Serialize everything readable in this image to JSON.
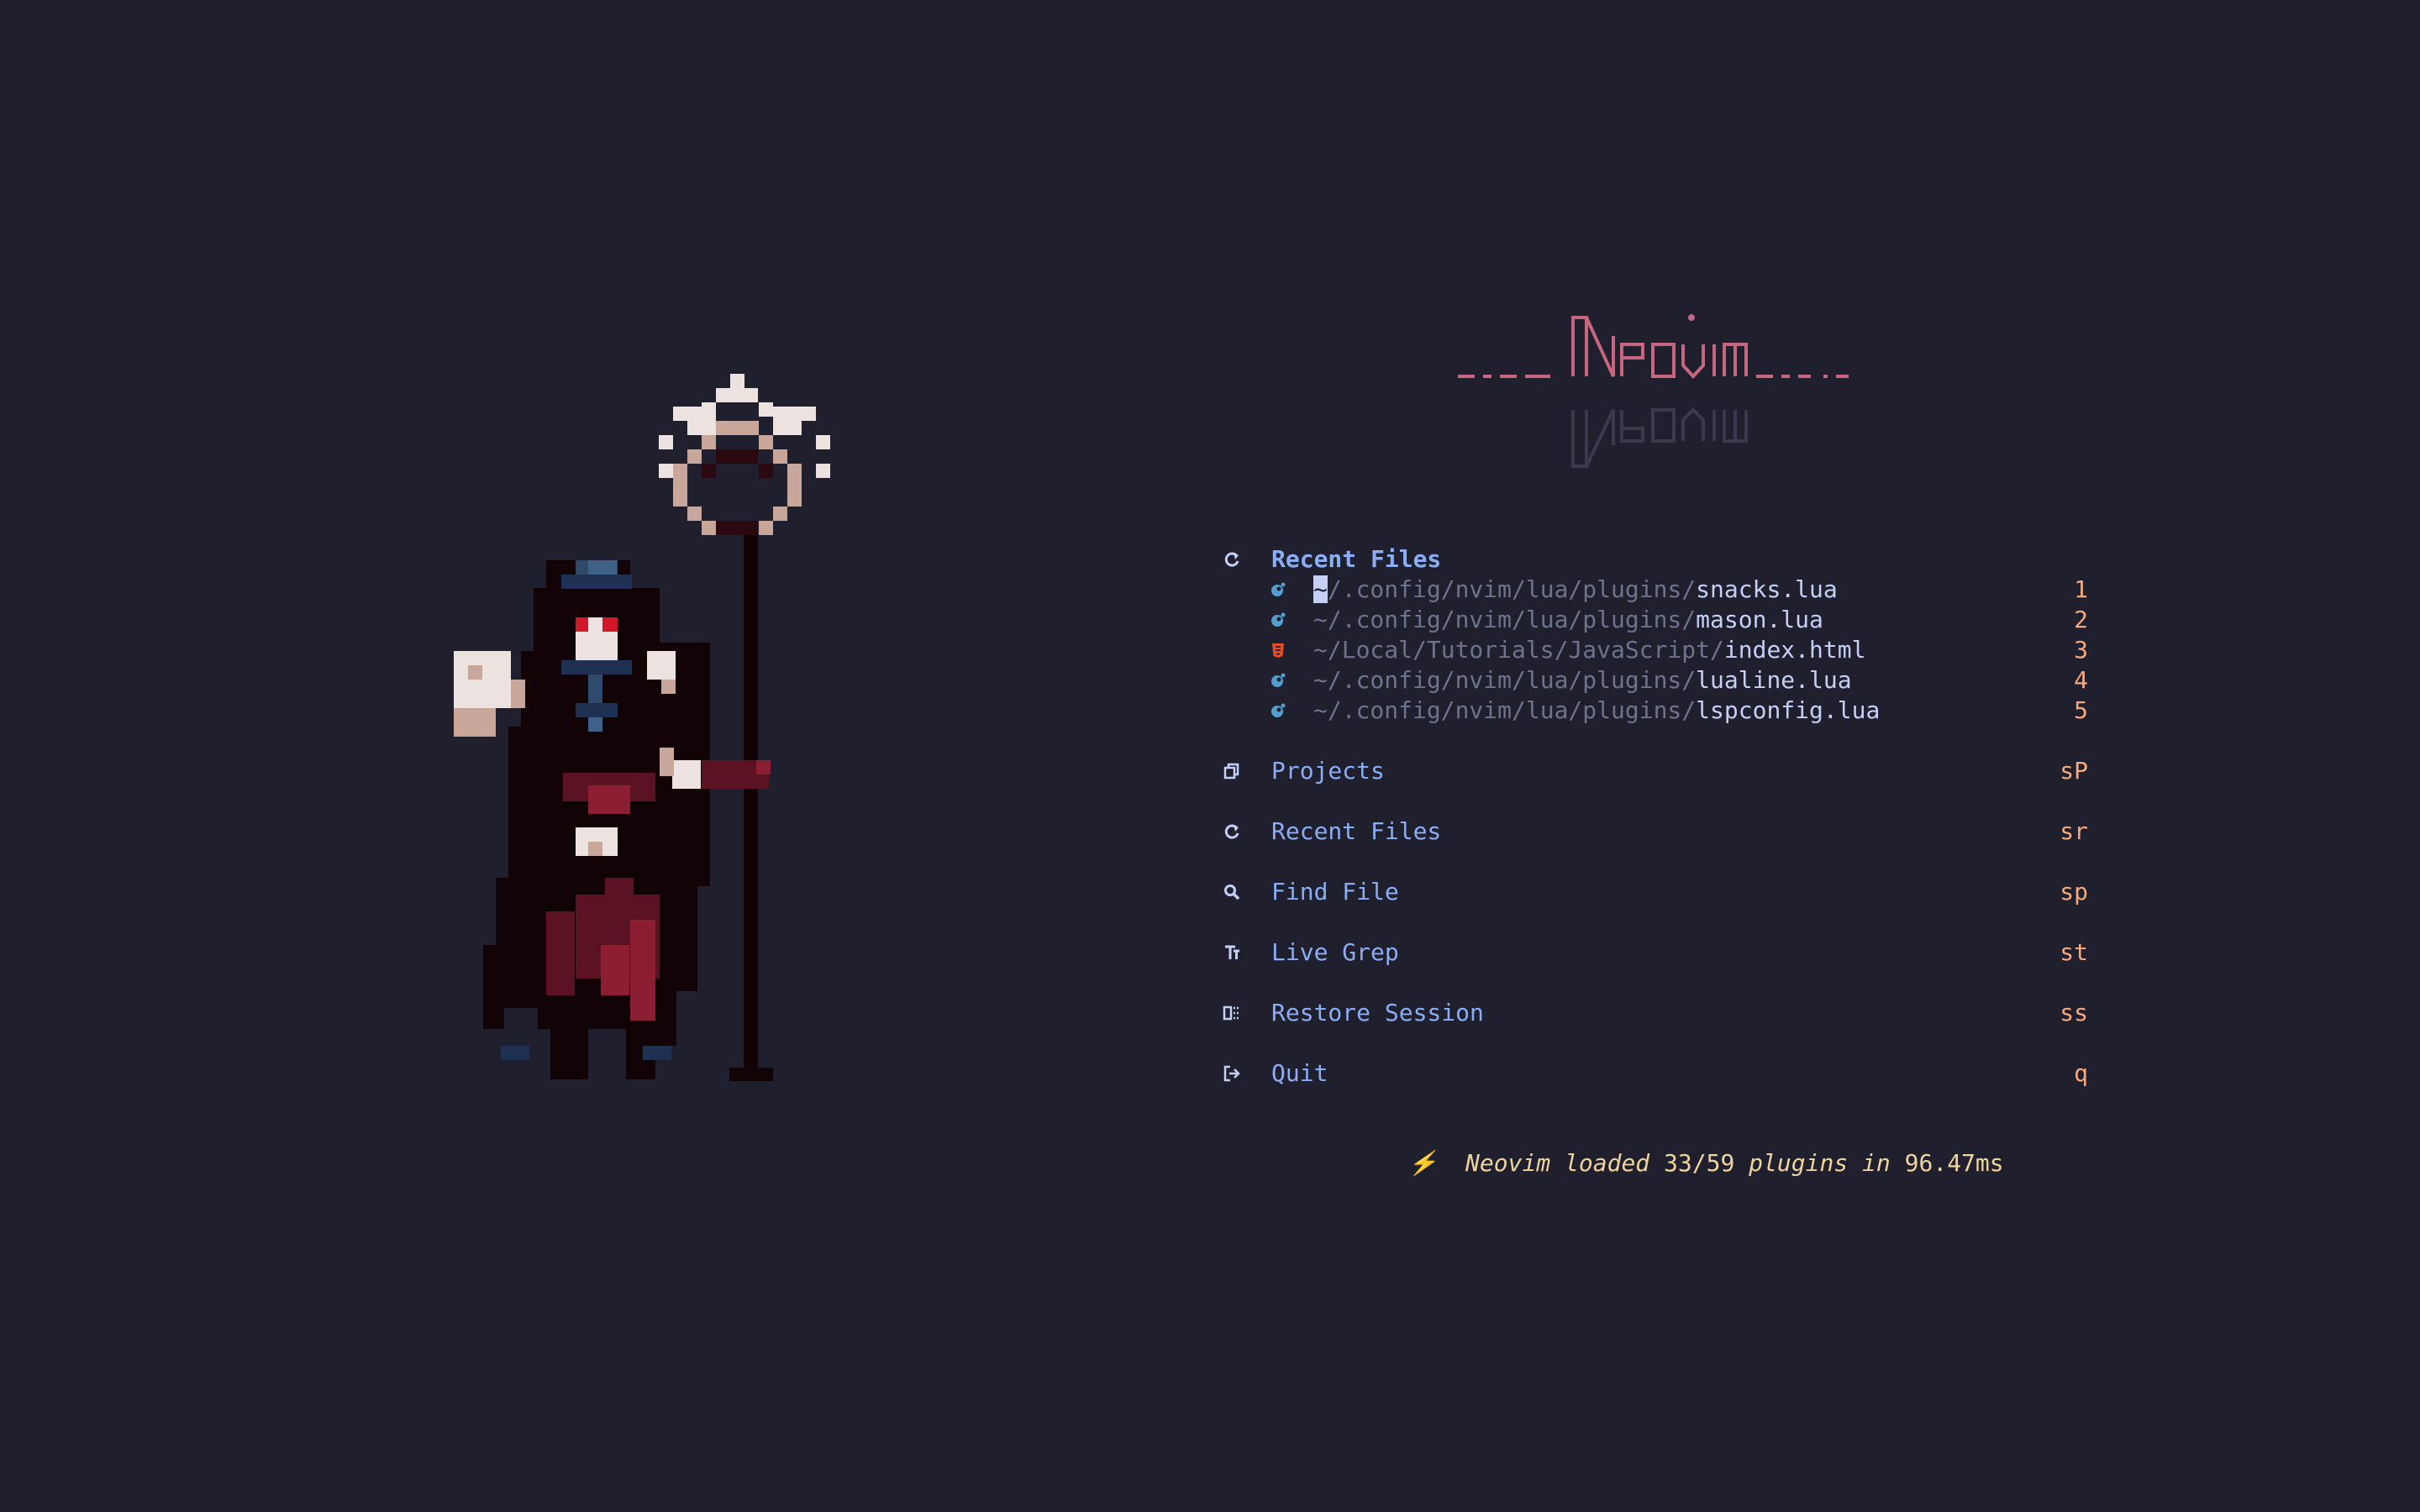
{
  "logo": {
    "text": "Neovim"
  },
  "recent_section": {
    "title": "Recent Files",
    "icon": "refresh-icon",
    "files": [
      {
        "prefix": "~/.config/nvim/lua/plugins/",
        "name": "snacks.lua",
        "key": "1",
        "icon": "lua-icon"
      },
      {
        "prefix": "~/.config/nvim/lua/plugins/",
        "name": "mason.lua",
        "key": "2",
        "icon": "lua-icon"
      },
      {
        "prefix": "~/Local/Tutorials/JavaScript/",
        "name": "index.html",
        "key": "3",
        "icon": "html5-icon"
      },
      {
        "prefix": "~/.config/nvim/lua/plugins/",
        "name": "lualine.lua",
        "key": "4",
        "icon": "lua-icon"
      },
      {
        "prefix": "~/.config/nvim/lua/plugins/",
        "name": "lspconfig.lua",
        "key": "5",
        "icon": "lua-icon"
      }
    ]
  },
  "actions": [
    {
      "label": "Projects",
      "key": "sP",
      "icon": "copy-icon"
    },
    {
      "label": "Recent Files",
      "key": "sr",
      "icon": "refresh-icon"
    },
    {
      "label": "Find File",
      "key": "sp",
      "icon": "search-icon"
    },
    {
      "label": "Live Grep",
      "key": "st",
      "icon": "text-icon"
    },
    {
      "label": "Restore Session",
      "key": "ss",
      "icon": "session-icon"
    },
    {
      "label": "Quit",
      "key": "q",
      "icon": "exit-icon"
    }
  ],
  "footer": {
    "icon": "lightning-icon",
    "prefix": "Neovim loaded ",
    "loaded": "33/59",
    "middle": " plugins in ",
    "time": "96.47ms"
  },
  "colors": {
    "background": "#1f1f2e",
    "accent_blue": "#8aadf4",
    "key_orange": "#f5a97f",
    "footer_yellow": "#eed49f",
    "logo_pink": "#c7677f",
    "path_gray": "#6e738d"
  }
}
